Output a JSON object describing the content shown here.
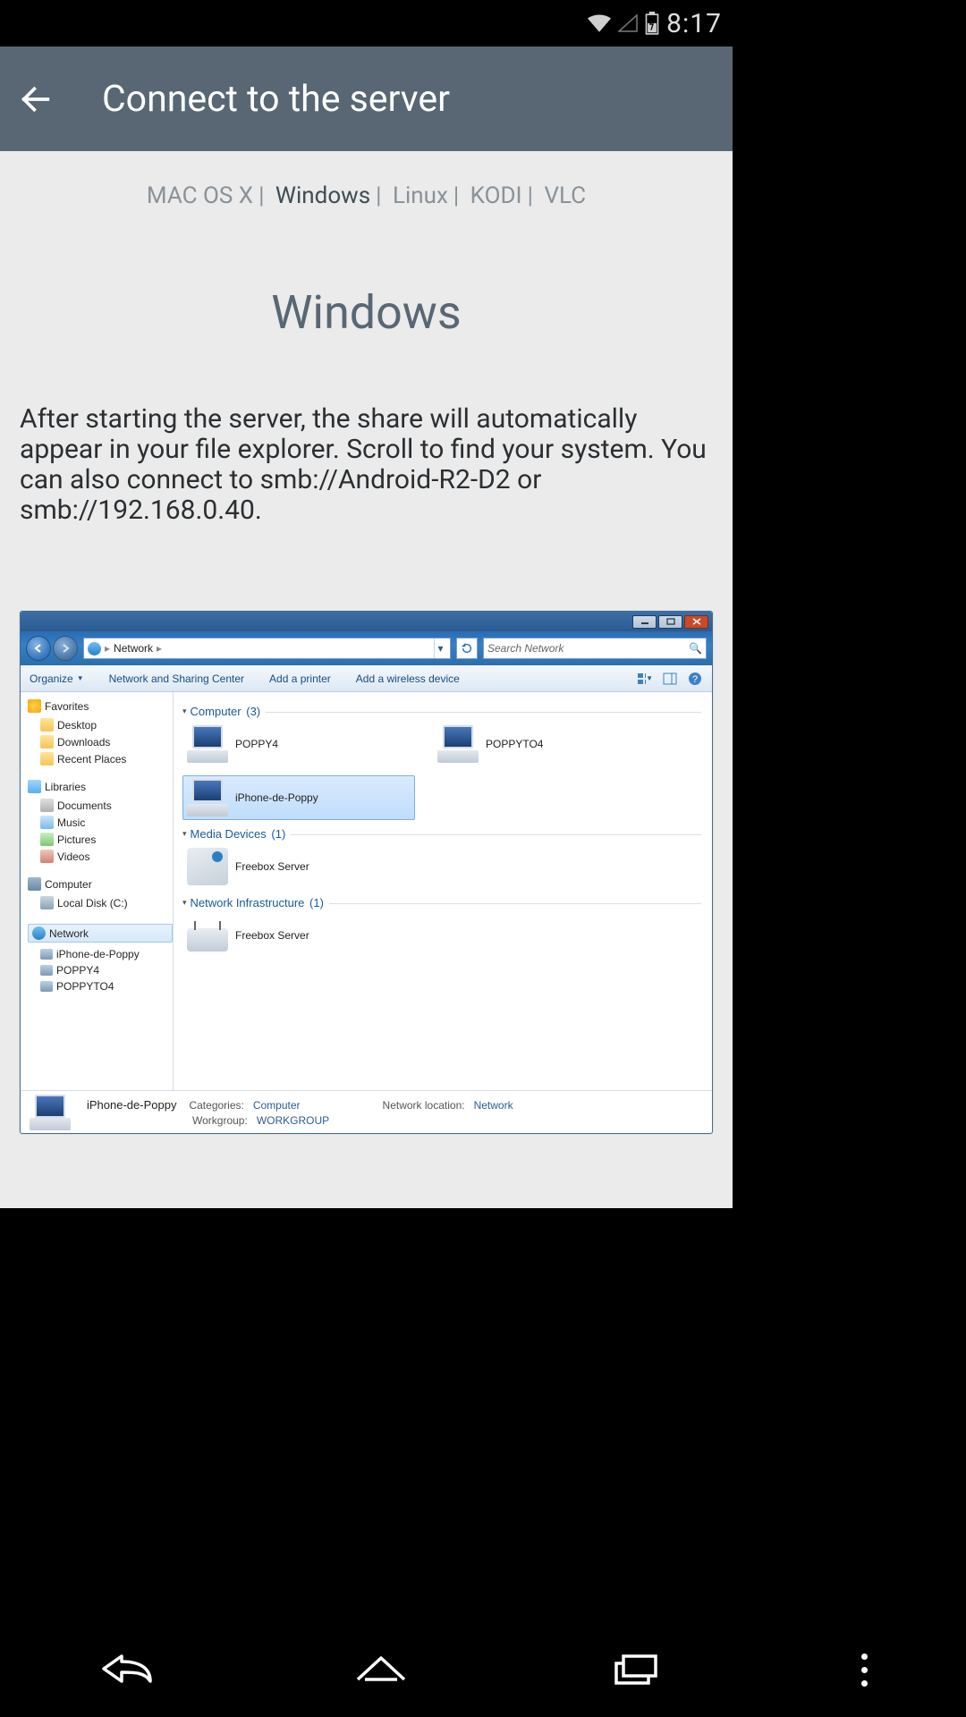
{
  "status_bar": {
    "clock": "8:17"
  },
  "app_bar": {
    "title": "Connect to the server"
  },
  "tabs": [
    "MAC OS X",
    "Windows",
    "Linux",
    "KODI",
    "VLC"
  ],
  "selected_tab_index": 1,
  "heading": "Windows",
  "body": "After starting the server, the share will automatically appear in your file explorer. Scroll to find your system. You can also connect to smb://Android-R2-D2 or smb://192.168.0.40.",
  "explorer": {
    "breadcrumb": [
      "Network"
    ],
    "search_placeholder": "Search Network",
    "toolbar": {
      "organize": "Organize",
      "network_center": "Network and Sharing Center",
      "add_printer": "Add a printer",
      "add_wireless": "Add a wireless device"
    },
    "sidebar": {
      "favorites": {
        "label": "Favorites",
        "items": [
          "Desktop",
          "Downloads",
          "Recent Places"
        ]
      },
      "libraries": {
        "label": "Libraries",
        "items": [
          "Documents",
          "Music",
          "Pictures",
          "Videos"
        ]
      },
      "computer": {
        "label": "Computer",
        "items": [
          "Local Disk (C:)"
        ]
      },
      "network": {
        "label": "Network",
        "items": [
          "iPhone-de-Poppy",
          "POPPY4",
          "POPPYTO4"
        ]
      }
    },
    "groups": {
      "computer": {
        "label": "Computer",
        "count": "(3)",
        "items": [
          "POPPY4",
          "POPPYTO4",
          "iPhone-de-Poppy"
        ]
      },
      "media": {
        "label": "Media Devices",
        "count": "(1)",
        "items": [
          "Freebox Server"
        ]
      },
      "infra": {
        "label": "Network Infrastructure",
        "count": "(1)",
        "items": [
          "Freebox Server"
        ]
      }
    },
    "status": {
      "name": "iPhone-de-Poppy",
      "categories_label": "Categories:",
      "categories_value": "Computer",
      "workgroup_label": "Workgroup:",
      "workgroup_value": "WORKGROUP",
      "netloc_label": "Network location:",
      "netloc_value": "Network"
    }
  }
}
